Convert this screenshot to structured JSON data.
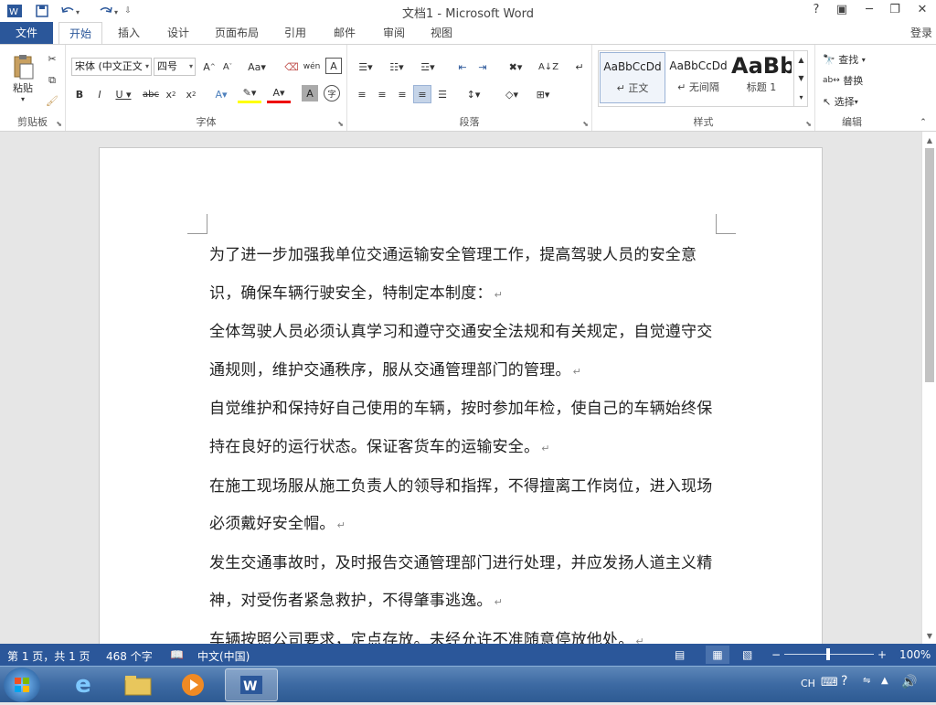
{
  "app": {
    "title": "文档1 - Microsoft Word",
    "login": "登录"
  },
  "quick_access": [
    "word-logo-icon",
    "save-icon",
    "undo-icon",
    "redo-icon",
    "customize-icon"
  ],
  "tabs": [
    {
      "label": "文件"
    },
    {
      "label": "开始"
    },
    {
      "label": "插入"
    },
    {
      "label": "设计"
    },
    {
      "label": "页面布局"
    },
    {
      "label": "引用"
    },
    {
      "label": "邮件"
    },
    {
      "label": "审阅"
    },
    {
      "label": "视图"
    }
  ],
  "ribbon": {
    "clipboard": {
      "label": "剪贴板",
      "paste": "粘贴"
    },
    "font": {
      "label": "字体",
      "font_name": "宋体 (中文正文",
      "font_size": "四号"
    },
    "paragraph": {
      "label": "段落"
    },
    "styles": {
      "label": "样式",
      "items": [
        {
          "preview": "AaBbCcDd",
          "name": "↵ 正文"
        },
        {
          "preview": "AaBbCcDd",
          "name": "↵ 无间隔"
        },
        {
          "preview": "AaBb",
          "name": "标题 1"
        }
      ]
    },
    "editing": {
      "label": "编辑",
      "find": "查找",
      "replace": "替换",
      "select": "选择"
    }
  },
  "document": {
    "paragraphs": [
      "为了进一步加强我单位交通运输安全管理工作，提高驾驶人员的安全意识，确保车辆行驶安全，特制定本制度：",
      "全体驾驶人员必须认真学习和遵守交通安全法规和有关规定，自觉遵守交通规则，维护交通秩序，服从交通管理部门的管理。",
      "自觉维护和保持好自己使用的车辆，按时参加年检，使自己的车辆始终保持在良好的运行状态。保证客货车的运输安全。",
      "在施工现场服从施工负责人的领导和指挥，不得擅离工作岗位，进入现场必须戴好安全帽。",
      "发生交通事故时，及时报告交通管理部门进行处理，并应发扬人道主义精神，对受伤者紧急救护，不得肇事逃逸。",
      "车辆按照公司要求，定点存放。未经允许不准随意停放他处。"
    ],
    "para_mark": "↵"
  },
  "status": {
    "page": "第 1 页，共 1 页",
    "words": "468 个字",
    "language": "中文(中国)",
    "zoom": "100%"
  },
  "tray": {
    "ime": "CH"
  },
  "colors": {
    "accent": "#2b579a",
    "taskbar": "#3d6aa3"
  }
}
